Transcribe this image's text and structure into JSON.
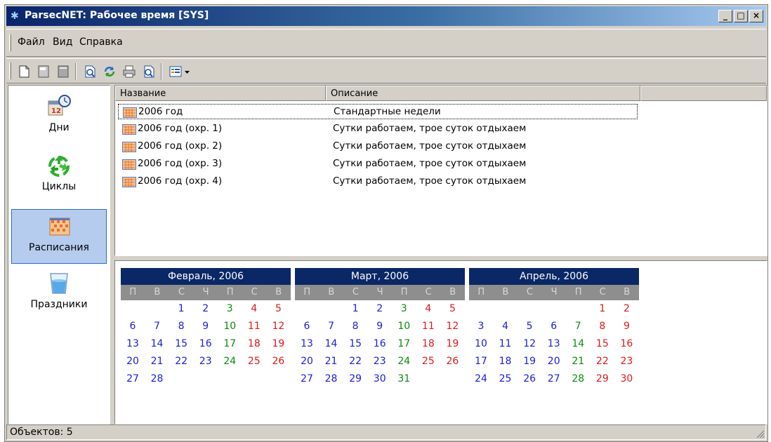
{
  "window": {
    "title": "ParsecNET: Рабочее время [SYS]",
    "controls": {
      "minimize": "_",
      "maximize": "□",
      "close": "×"
    }
  },
  "menu": [
    {
      "label": "Файл"
    },
    {
      "label": "Вид"
    },
    {
      "label": "Справка"
    }
  ],
  "toolbar": {
    "buttons": [
      "new-document-icon",
      "properties-icon",
      "delete-icon",
      "preview-icon",
      "refresh-icon",
      "print-icon",
      "print-preview-icon",
      "view-mode-icon",
      "dropdown-arrow-icon"
    ]
  },
  "sidebar": {
    "items": [
      {
        "label": "Дни",
        "icon": "calendar-clock-icon",
        "selected": false
      },
      {
        "label": "Циклы",
        "icon": "recycle-icon",
        "selected": false
      },
      {
        "label": "Расписания",
        "icon": "schedule-grid-icon",
        "selected": true
      },
      {
        "label": "Праздники",
        "icon": "water-glass-icon",
        "selected": false
      }
    ]
  },
  "list": {
    "columns": [
      "Название",
      "Описание"
    ],
    "rows": [
      {
        "name": "2006 год",
        "description": "Стандартные недели"
      },
      {
        "name": "2006 год (охр. 1)",
        "description": "Сутки работаем, трое суток отдыхаем"
      },
      {
        "name": "2006 год (охр. 2)",
        "description": "Сутки работаем, трое суток отдыхаем"
      },
      {
        "name": "2006 год (охр. 3)",
        "description": "Сутки работаем, трое суток отдыхаем"
      },
      {
        "name": "2006 год (охр. 4)",
        "description": "Сутки работаем, трое суток отдыхаем"
      }
    ]
  },
  "calendar": {
    "weekdays": [
      "П",
      "В",
      "С",
      "Ч",
      "П",
      "С",
      "В"
    ],
    "colors": {
      "work": "#1c1cd8",
      "shortened": "#0d8a0d",
      "weekend": "#e01818"
    },
    "months": [
      {
        "title": "Февраль, 2006",
        "first_weekday": 2,
        "days": 28,
        "green": [
          3,
          10,
          17,
          24
        ],
        "red": [
          4,
          5,
          11,
          12,
          18,
          19,
          25,
          26
        ]
      },
      {
        "title": "Март, 2006",
        "first_weekday": 2,
        "days": 31,
        "green": [
          3,
          10,
          17,
          24,
          31
        ],
        "red": [
          4,
          5,
          11,
          12,
          18,
          19,
          25,
          26
        ]
      },
      {
        "title": "Апрель, 2006",
        "first_weekday": 5,
        "days": 30,
        "green": [
          7,
          14,
          21,
          28
        ],
        "red": [
          1,
          2,
          8,
          9,
          15,
          16,
          22,
          23,
          29,
          30
        ]
      }
    ]
  },
  "status": {
    "objects": "Объектов: 5"
  }
}
